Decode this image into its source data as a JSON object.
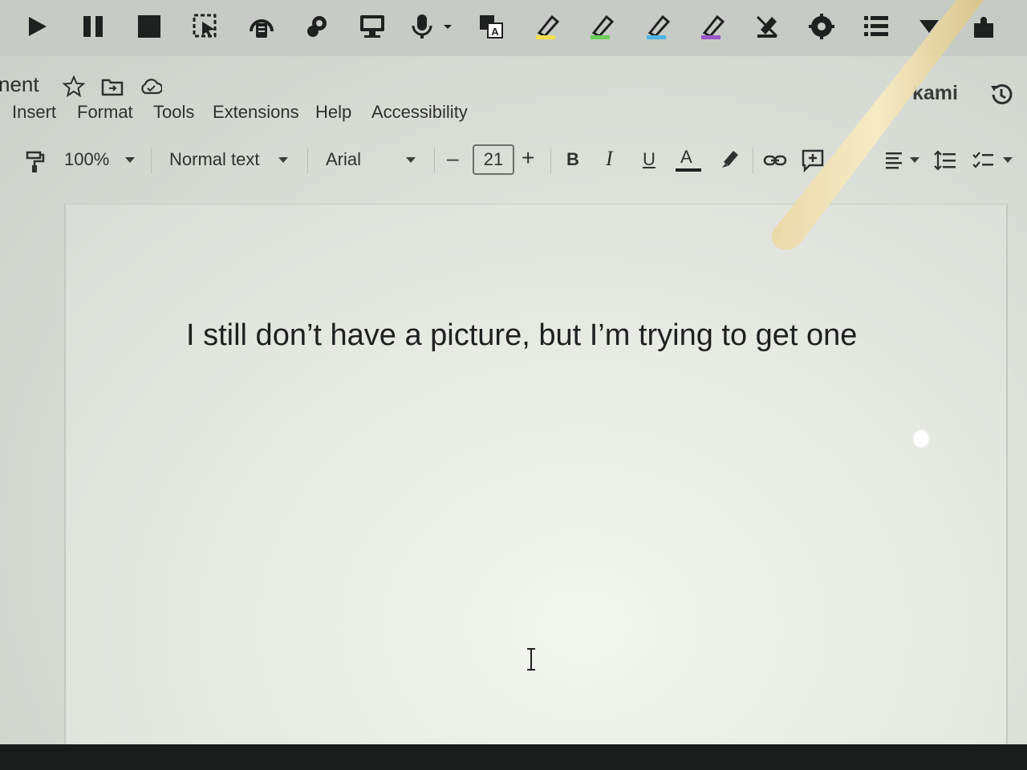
{
  "extension_bar": {
    "icons": [
      "play-icon",
      "pause-icon",
      "stop-icon",
      "screenshot-select-icon",
      "audio-icon",
      "dictionary-icon",
      "picture-dictionary-icon",
      "microphone-icon",
      "translate-icon",
      "highlighter-yellow-icon",
      "highlighter-green-icon",
      "highlighter-blue-icon",
      "highlighter-purple-icon",
      "remove-highlight-icon",
      "settings-icon",
      "list-icon",
      "dropdown-icon",
      "extension-icon"
    ],
    "colors": {
      "yellow": "#f4e04a",
      "green": "#6ccf5a",
      "blue": "#4fb3e3",
      "purple": "#9a56c9"
    }
  },
  "title": {
    "doc_title": "nent",
    "brand": "kami"
  },
  "menu": {
    "items": [
      "Insert",
      "Format",
      "Tools",
      "Extensions",
      "Help",
      "Accessibility"
    ]
  },
  "toolbar": {
    "zoom": "100%",
    "style": "Normal text",
    "font": "Arial",
    "font_size": "21",
    "minus": "–",
    "plus": "+",
    "bold": "B",
    "italic": "I",
    "underline": "U",
    "text_color": "A"
  },
  "document": {
    "body_text": "I still don’t have a picture, but I’m trying to get one"
  }
}
